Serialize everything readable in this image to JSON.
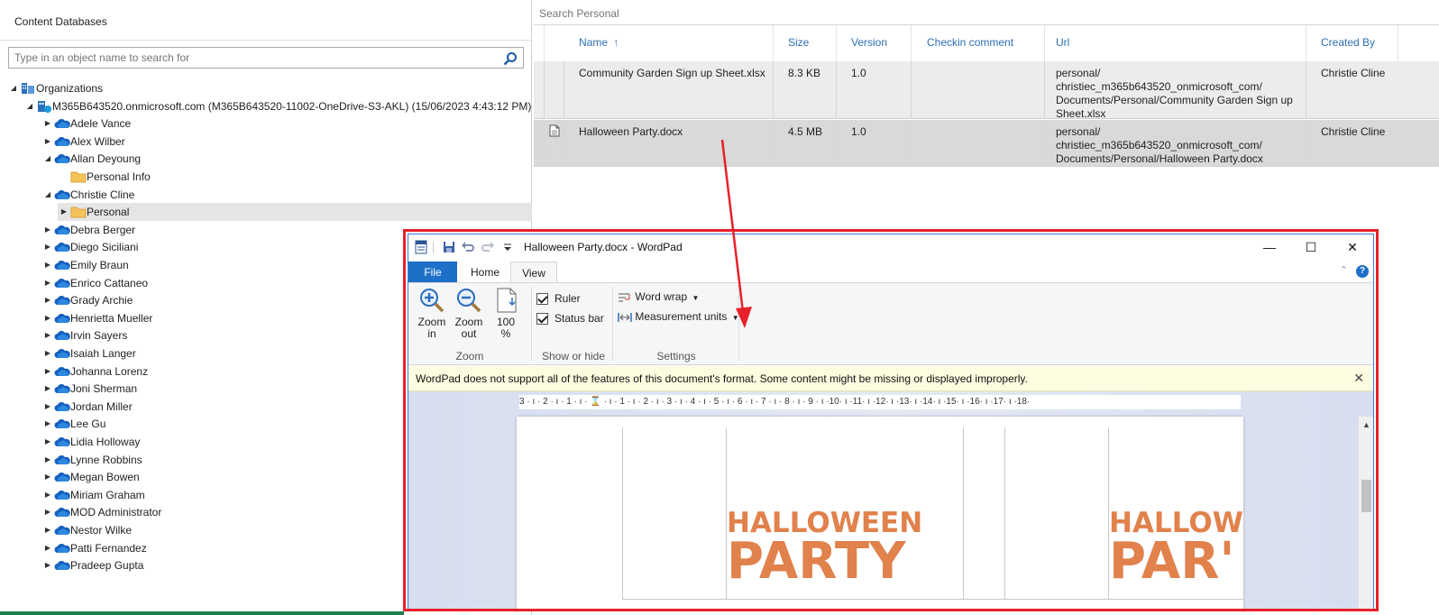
{
  "left_panel": {
    "title": "Content Databases",
    "search_placeholder": "Type in an object name to search for",
    "tree": [
      {
        "label": "Organizations",
        "level": 0,
        "expanded": true,
        "icon": "organization-icon"
      },
      {
        "label": "M365B643520.onmicrosoft.com (M365B643520-11002-OneDrive-S3-AKL) (15/06/2023 4:43:12 PM)",
        "level": 1,
        "expanded": true,
        "icon": "tenant-icon"
      },
      {
        "label": "Adele Vance",
        "level": 2,
        "expanded": false,
        "icon": "onedrive-cloud-icon"
      },
      {
        "label": "Alex Wilber",
        "level": 2,
        "expanded": false,
        "icon": "onedrive-cloud-icon"
      },
      {
        "label": "Allan Deyoung",
        "level": 2,
        "expanded": true,
        "icon": "onedrive-cloud-icon"
      },
      {
        "label": "Personal Info",
        "level": 3,
        "expanded": null,
        "icon": "folder-icon"
      },
      {
        "label": "Christie Cline",
        "level": 2,
        "expanded": true,
        "icon": "onedrive-cloud-icon"
      },
      {
        "label": "Personal",
        "level": 3,
        "expanded": false,
        "icon": "folder-icon",
        "selected": true
      },
      {
        "label": "Debra Berger",
        "level": 2,
        "expanded": false,
        "icon": "onedrive-cloud-icon"
      },
      {
        "label": "Diego Siciliani",
        "level": 2,
        "expanded": false,
        "icon": "onedrive-cloud-icon"
      },
      {
        "label": "Emily Braun",
        "level": 2,
        "expanded": false,
        "icon": "onedrive-cloud-icon"
      },
      {
        "label": "Enrico Cattaneo",
        "level": 2,
        "expanded": false,
        "icon": "onedrive-cloud-icon"
      },
      {
        "label": "Grady Archie",
        "level": 2,
        "expanded": false,
        "icon": "onedrive-cloud-icon"
      },
      {
        "label": "Henrietta Mueller",
        "level": 2,
        "expanded": false,
        "icon": "onedrive-cloud-icon"
      },
      {
        "label": "Irvin Sayers",
        "level": 2,
        "expanded": false,
        "icon": "onedrive-cloud-icon"
      },
      {
        "label": "Isaiah Langer",
        "level": 2,
        "expanded": false,
        "icon": "onedrive-cloud-icon"
      },
      {
        "label": "Johanna Lorenz",
        "level": 2,
        "expanded": false,
        "icon": "onedrive-cloud-icon"
      },
      {
        "label": "Joni Sherman",
        "level": 2,
        "expanded": false,
        "icon": "onedrive-cloud-icon"
      },
      {
        "label": "Jordan Miller",
        "level": 2,
        "expanded": false,
        "icon": "onedrive-cloud-icon"
      },
      {
        "label": "Lee Gu",
        "level": 2,
        "expanded": false,
        "icon": "onedrive-cloud-icon"
      },
      {
        "label": "Lidia Holloway",
        "level": 2,
        "expanded": false,
        "icon": "onedrive-cloud-icon"
      },
      {
        "label": "Lynne Robbins",
        "level": 2,
        "expanded": false,
        "icon": "onedrive-cloud-icon"
      },
      {
        "label": "Megan Bowen",
        "level": 2,
        "expanded": false,
        "icon": "onedrive-cloud-icon"
      },
      {
        "label": "Miriam Graham",
        "level": 2,
        "expanded": false,
        "icon": "onedrive-cloud-icon"
      },
      {
        "label": "MOD Administrator",
        "level": 2,
        "expanded": false,
        "icon": "onedrive-cloud-icon"
      },
      {
        "label": "Nestor Wilke",
        "level": 2,
        "expanded": false,
        "icon": "onedrive-cloud-icon"
      },
      {
        "label": "Patti Fernandez",
        "level": 2,
        "expanded": false,
        "icon": "onedrive-cloud-icon"
      },
      {
        "label": "Pradeep Gupta",
        "level": 2,
        "expanded": false,
        "icon": "onedrive-cloud-icon"
      }
    ]
  },
  "grid": {
    "search_placeholder": "Search Personal",
    "columns": {
      "name": "Name",
      "sort_indicator": "↑",
      "size": "Size",
      "version": "Version",
      "comment": "Checkin comment",
      "url": "Url",
      "created_by": "Created By"
    },
    "rows": [
      {
        "name": "Community Garden Sign up Sheet.xlsx",
        "size": "8.3 KB",
        "version": "1.0",
        "comment": "",
        "url_lines": [
          "personal/",
          "christiec_m365b643520_onmicrosoft_com/",
          "Documents/Personal/Community Garden Sign up",
          "Sheet.xlsx"
        ],
        "created_by": "Christie Cline",
        "selected": false
      },
      {
        "name": "Halloween Party.docx",
        "size": "4.5 MB",
        "version": "1.0",
        "comment": "",
        "url_lines": [
          "personal/",
          "christiec_m365b643520_onmicrosoft_com/",
          "Documents/Personal/Halloween Party.docx"
        ],
        "created_by": "Christie Cline",
        "selected": true,
        "icon": "document-icon"
      }
    ]
  },
  "wordpad": {
    "title": "Halloween Party.docx - WordPad",
    "tabs": {
      "file": "File",
      "home": "Home",
      "view": "View"
    },
    "ribbon": {
      "zoom_in": [
        "Zoom",
        "in"
      ],
      "zoom_out": [
        "Zoom",
        "out"
      ],
      "zoom_100": [
        "100",
        "%"
      ],
      "group_zoom": "Zoom",
      "ruler": "Ruler",
      "status_bar": "Status bar",
      "group_show_hide": "Show or hide",
      "word_wrap": "Word wrap",
      "measurement_units": "Measurement units",
      "group_settings": "Settings"
    },
    "notice": "WordPad does not support all of the features of this document's format. Some content might be missing or displayed improperly.",
    "ruler_text": "3 · ı · 2 · ı · 1 · ı · ⌛ · ı · 1 · ı · 2 · ı · 3 · ı · 4 · ı · 5 · ı · 6 · ı · 7 · ı · 8 · ı · 9 · ı ·10· ı ·11· ı ·12· ı ·13· ı ·14· ı ·15· ı ·16· ı ·17· ı ·18·",
    "doc": {
      "line1_a": "HALLOWEEN",
      "line2_a": "PARTY",
      "line1_b": "HALLOW",
      "line2_b": "PAR'"
    }
  },
  "colors": {
    "annotation_red": "#e8202a",
    "header_blue": "#2e6fb5",
    "file_tab_blue": "#1e6fc8",
    "halloween_orange": "#e1814c"
  }
}
